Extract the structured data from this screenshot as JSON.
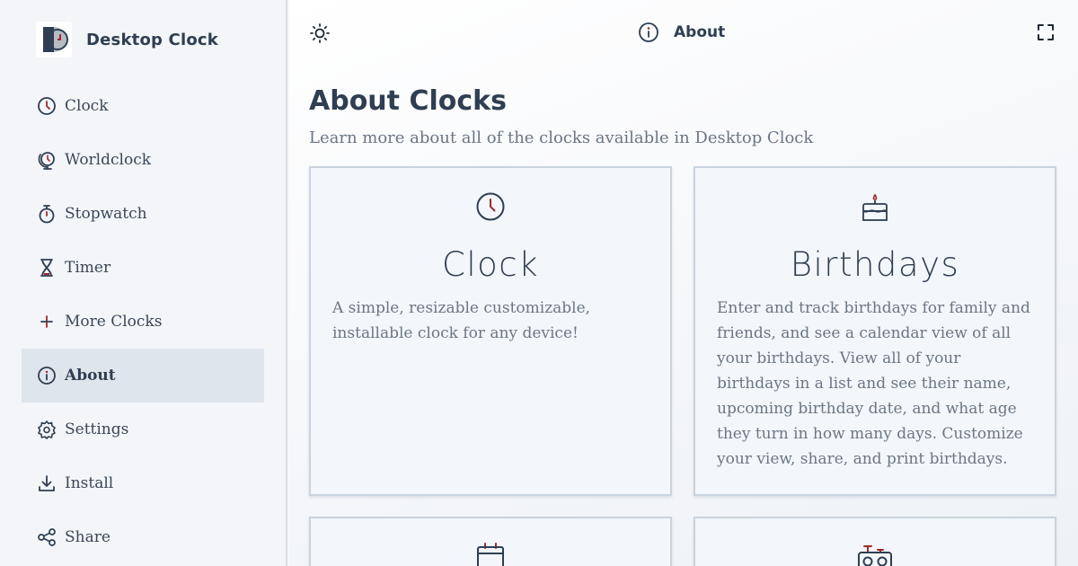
{
  "app": {
    "name": "Desktop Clock"
  },
  "sidebar": {
    "items": [
      {
        "label": "Clock",
        "icon": "clock-icon"
      },
      {
        "label": "Worldclock",
        "icon": "globe-clock-icon"
      },
      {
        "label": "Stopwatch",
        "icon": "stopwatch-icon"
      },
      {
        "label": "Timer",
        "icon": "hourglass-icon"
      },
      {
        "label": "More Clocks",
        "icon": "plus-icon"
      },
      {
        "label": "About",
        "icon": "info-icon",
        "active": true
      },
      {
        "label": "Settings",
        "icon": "gear-icon"
      },
      {
        "label": "Install",
        "icon": "download-icon"
      },
      {
        "label": "Share",
        "icon": "share-icon"
      }
    ]
  },
  "topbar": {
    "title": "About",
    "theme_icon": "sun-icon",
    "fullscreen_icon": "fullscreen-icon"
  },
  "main": {
    "heading": "About Clocks",
    "subheading": "Learn more about all of the clocks available in Desktop Clock",
    "cards": [
      {
        "title": "Clock",
        "icon": "clock-icon",
        "description": "A simple, resizable customizable, installable clock for any device!"
      },
      {
        "title": "Birthdays",
        "icon": "cake-icon",
        "description": "Enter and track birthdays for family and friends, and see a calendar view of all your birthdays. View all of your birthdays in a list and see their name, upcoming birthday date, and what age they turn in how many days. Customize your view, share, and print birthdays."
      },
      {
        "title": "",
        "icon": "calendar-icon",
        "description": ""
      },
      {
        "title": "",
        "icon": "radio-icon",
        "description": ""
      }
    ]
  },
  "colors": {
    "text": "#2f3e52",
    "accent": "#a1272e",
    "active_bg": "#dfe5ec",
    "border": "#c9d3de"
  }
}
